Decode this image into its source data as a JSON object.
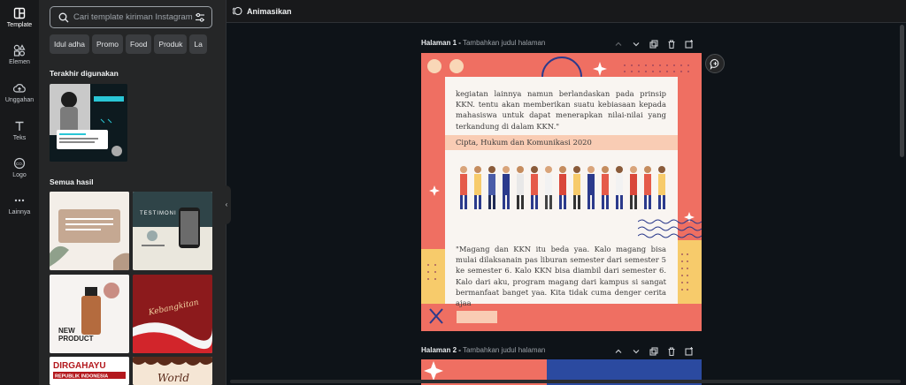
{
  "rail": {
    "items": [
      {
        "label": "Template",
        "icon": "template-icon"
      },
      {
        "label": "Elemen",
        "icon": "elements-icon"
      },
      {
        "label": "Unggahan",
        "icon": "upload-cloud-icon"
      },
      {
        "label": "Teks",
        "icon": "text-icon"
      },
      {
        "label": "Logo",
        "icon": "logo-icon"
      },
      {
        "label": "Lainnya",
        "icon": "more-dots-icon"
      }
    ]
  },
  "panel": {
    "search_placeholder": "Cari template kiriman Instagram",
    "chips": [
      "Idul adha",
      "Promo",
      "Food",
      "Produk",
      "La"
    ],
    "recent_title": "Terakhir digunakan",
    "all_title": "Semua hasil",
    "thumbs": {
      "t2_title": "TESTIMONI",
      "t3_line1": "NEW",
      "t3_line2": "PRODUCT",
      "t5_line1": "DIRGAHAYU",
      "t5_line2": "REPUBLIK INDONESIA",
      "t6_word": "World"
    }
  },
  "topbar": {
    "animate_label": "Animasikan"
  },
  "pages": [
    {
      "label": "Halaman 1 -",
      "placeholder": "Tambahkan judul halaman"
    },
    {
      "label": "Halaman 2 -",
      "placeholder": "Tambahkan judul halaman"
    }
  ],
  "canvas1": {
    "para1": "kegiatan lainnya namun berlandaskan pada prinsip KKN. tentu akan memberikan suatu kebiasaan kepada mahasiswa untuk dapat menerapkan nilai-nilai yang terkandung di dalam KKN.\"",
    "band": "Cipta, Hukum dan Komunikasi 2020",
    "para2": "\"Magang dan KKN itu beda yaa. Kalo magang bisa mulai dilaksanain pas liburan semester dari semester 5 ke semester 6. Kalo KKN bisa diambil dari semester 6. Kalo dari aku, program magang dari kampus si sangat bermanfaat banget yaa. Kita tidak cuma denger cerita ajaa"
  },
  "colors": {
    "coral": "#ef6f62",
    "yellow": "#f7cb6b",
    "navy": "#2b3a8c",
    "peach": "#f9ccb4",
    "cream": "#f9f5f1"
  }
}
